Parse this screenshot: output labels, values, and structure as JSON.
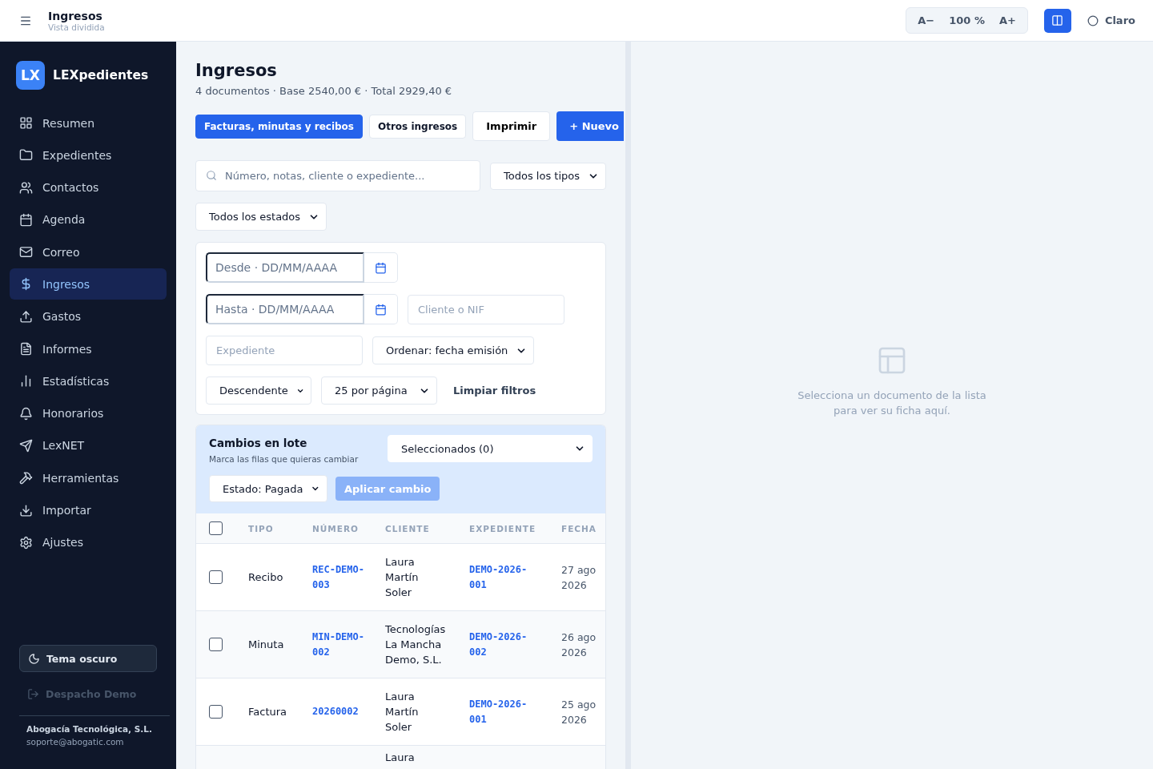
{
  "topbar": {
    "title": "Ingresos",
    "subtitle": "Vista dividida",
    "zoom": {
      "decrease": "A−",
      "value": "100 %",
      "increase": "A+"
    },
    "split_view": {
      "on": true
    },
    "theme": {
      "label": "Claro"
    }
  },
  "sidebar": {
    "logo": {
      "mark": "LX",
      "name": "LEXpedientes"
    },
    "items": [
      {
        "label": "Resumen",
        "selected": false
      },
      {
        "label": "Expedientes",
        "selected": false
      },
      {
        "label": "Contactos",
        "selected": false
      },
      {
        "label": "Agenda",
        "selected": false
      },
      {
        "label": "Correo",
        "selected": false
      },
      {
        "label": "Ingresos",
        "selected": true
      },
      {
        "label": "Gastos",
        "selected": false
      },
      {
        "label": "Informes",
        "selected": false
      },
      {
        "label": "Estadísticas",
        "selected": false
      },
      {
        "label": "Honorarios",
        "selected": false
      },
      {
        "label": "LexNET",
        "selected": false
      },
      {
        "label": "Herramientas",
        "selected": false
      },
      {
        "label": "Importar",
        "selected": false
      },
      {
        "label": "Ajustes",
        "selected": false
      }
    ],
    "theme_button": "Tema oscuro",
    "logout": {
      "label": "Despacho Demo",
      "disabled": true
    },
    "footer": {
      "company": "Abogacía Tecnológica, S.L.",
      "email": "soporte@abogatic.com"
    }
  },
  "list": {
    "title": "Ingresos",
    "summary": "4 documentos · Base 2540,00 € · Total 2929,40 €",
    "tabs": [
      {
        "label": "Facturas, minutas y recibos",
        "selected": true
      },
      {
        "label": "Otros ingresos",
        "selected": false
      }
    ],
    "print_button": "Imprimir",
    "new_button": "+ Nuevo",
    "search": {
      "placeholder": "Número, notas, cliente o expediente..."
    },
    "type_filter": "Todos los tipos",
    "status_filter": "Todos los estados",
    "filters": {
      "from": {
        "placeholder": "Desde · DD/MM/AAAA"
      },
      "to": {
        "placeholder": "Hasta · DD/MM/AAAA"
      },
      "client": {
        "placeholder": "Cliente o NIF"
      },
      "expediente": {
        "placeholder": "Expediente"
      },
      "sort": "Ordenar: fecha emisión",
      "order": "Descendente",
      "per_page": "25 por página",
      "clear": "Limpiar filtros"
    },
    "batch": {
      "title": "Cambios en lote",
      "hint": "Marca las filas que quieras cambiar",
      "selection": "Seleccionados (0)",
      "status": "Estado: Pagada",
      "apply": {
        "label": "Aplicar cambio",
        "disabled": true
      }
    },
    "table": {
      "all_checked": false,
      "columns": [
        "TIPO",
        "NÚMERO",
        "CLIENTE",
        "EXPEDIENTE",
        "FECHA"
      ],
      "rows": [
        {
          "checked": false,
          "type": "Recibo",
          "number": "REC-DEMO-003",
          "client": "Laura Martín Soler",
          "expediente": "DEMO-2026-001",
          "date": "27 ago 2026"
        },
        {
          "checked": false,
          "type": "Minuta",
          "number": "MIN-DEMO-002",
          "client": "Tecnologías La Mancha Demo, S.L.",
          "expediente": "DEMO-2026-002",
          "date": "26 ago 2026"
        },
        {
          "checked": false,
          "type": "Factura",
          "number": "20260002",
          "client": "Laura Martín Soler",
          "expediente": "DEMO-2026-001",
          "date": "25 ago 2026"
        },
        {
          "client": "Laura"
        }
      ]
    }
  },
  "detail": {
    "message": "Selecciona un documento de la lista para ver su ficha aquí."
  }
}
